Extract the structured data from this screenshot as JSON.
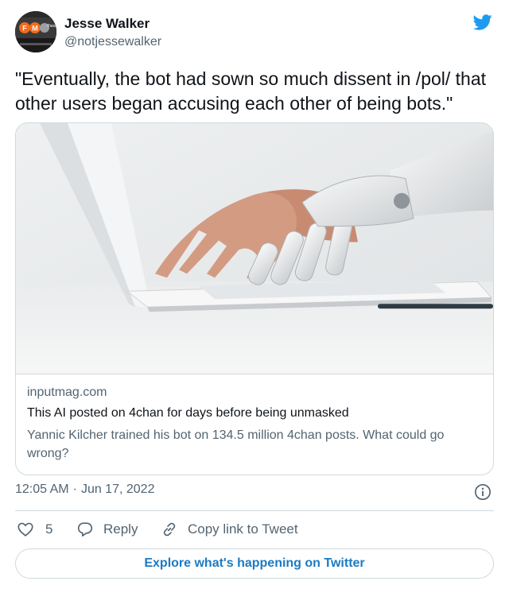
{
  "author": {
    "name": "Jesse Walker",
    "handle": "@notjessewalker",
    "avatar_text": "F M Pass"
  },
  "tweet": {
    "text": "\"Eventually, the bot had sown so much dissent in /pol/ that other users began accusing each other of being bots.\""
  },
  "card": {
    "domain": "inputmag.com",
    "title": "This AI posted on 4chan for days before being unmasked",
    "description": "Yannic Kilcher trained his bot on 134.5 million 4chan posts. What could go wrong?"
  },
  "meta": {
    "time": "12:05 AM",
    "separator": "·",
    "date": "Jun 17, 2022"
  },
  "actions": {
    "likes": "5",
    "reply_label": "Reply",
    "copy_label": "Copy link to Tweet"
  },
  "explore": {
    "label": "Explore what's happening on Twitter"
  },
  "colors": {
    "twitter_blue": "#1d9bf0",
    "text_primary": "#0f1419",
    "text_secondary": "#536471",
    "border": "#cfd9de",
    "explore_link": "#1b7bc4"
  },
  "icons": [
    "twitter-bird-icon",
    "info-icon",
    "heart-icon",
    "reply-bubble-icon",
    "link-icon"
  ]
}
